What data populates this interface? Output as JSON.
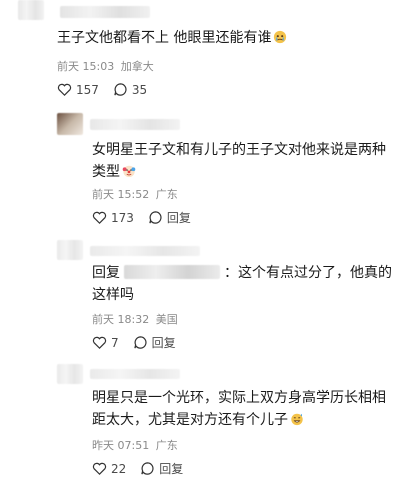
{
  "comments": [
    {
      "text": "王子文他都看不上 他眼里还能有谁",
      "time": "前天 15:03",
      "location": "加拿大",
      "likes": "157",
      "replies": "35"
    },
    {
      "text_line1": "女明星王子文和有儿子的王子文对他来说是两种",
      "text_line2": "类型",
      "time": "前天 15:52",
      "location": "广东",
      "likes": "173",
      "reply_label": "回复"
    },
    {
      "reply_prefix": "回复",
      "text_line1": "：这个有点过分了，他真的",
      "text_line2": "这样吗",
      "time": "前天 18:32",
      "location": "美国",
      "likes": "7",
      "reply_label": "回复"
    },
    {
      "text_line1": "明星只是一个光环，实际上双方身高学历长相相",
      "text_line2": "距太大，尤其是对方还有个儿子",
      "time": "昨天 07:51",
      "location": "广东",
      "likes": "22",
      "reply_label": "回复"
    }
  ],
  "icons": {
    "like": "heart-icon",
    "comment": "chat-bubble-icon",
    "emoji_cry": "crying-face-icon",
    "emoji_clown": "clown-face-icon",
    "emoji_grin": "grinning-sweat-icon"
  }
}
